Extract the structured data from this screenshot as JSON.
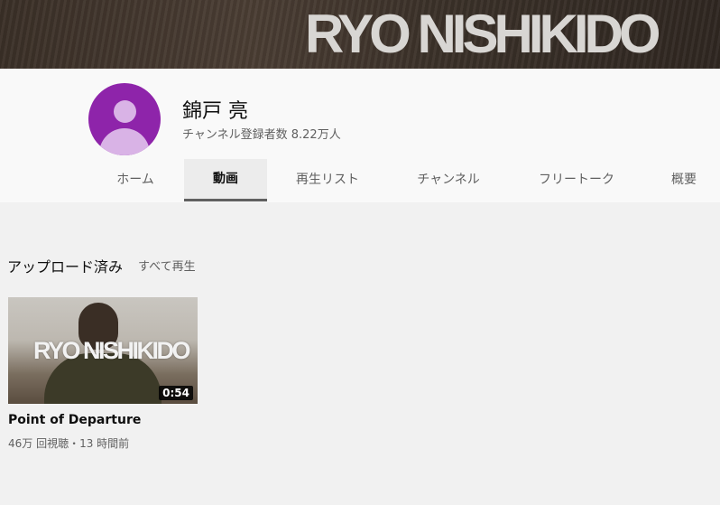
{
  "banner": {
    "text": "RYO NISHIKIDO"
  },
  "channel": {
    "name": "錦戸 亮",
    "subscribers": "チャンネル登録者数 8.22万人"
  },
  "tabs": [
    {
      "label": "ホーム",
      "active": false
    },
    {
      "label": "動画",
      "active": true
    },
    {
      "label": "再生リスト",
      "active": false
    },
    {
      "label": "チャンネル",
      "active": false
    },
    {
      "label": "フリートーク",
      "active": false
    },
    {
      "label": "概要",
      "active": false
    }
  ],
  "section": {
    "title": "アップロード済み",
    "play_all": "すべて再生"
  },
  "videos": [
    {
      "thumbnail_text": "RYO NISHIKIDO",
      "duration": "0:54",
      "title": "Point of Departure",
      "meta": "46万 回視聴・13 時間前"
    }
  ],
  "colors": {
    "avatar": "#8e24aa",
    "background": "#f1f1f1",
    "header": "#f9f9f9"
  }
}
